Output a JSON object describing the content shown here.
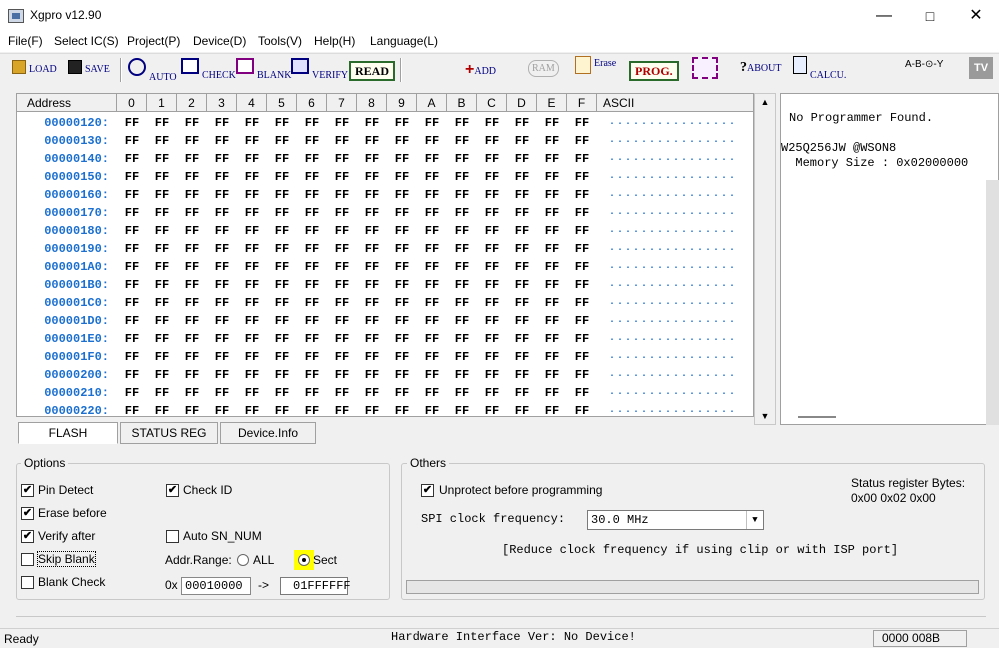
{
  "window": {
    "title": "Xgpro v12.90"
  },
  "menu": [
    "File(F)",
    "Select IC(S)",
    "Project(P)",
    "Device(D)",
    "Tools(V)",
    "Help(H)",
    "Language(L)"
  ],
  "toolbar": {
    "load": "LOAD",
    "save": "SAVE",
    "auto": "AUTO",
    "check": "CHECK",
    "blank": "BLANK",
    "verify": "VERIFY",
    "read": "READ",
    "add": "ADD",
    "ram": "RAM",
    "erase": "Erase",
    "prog": "PROG.",
    "about": "ABOUT",
    "calcu": "CALCU.",
    "tv": "TV"
  },
  "hex": {
    "columns": [
      "Address",
      "0",
      "1",
      "2",
      "3",
      "4",
      "5",
      "6",
      "7",
      "8",
      "9",
      "A",
      "B",
      "C",
      "D",
      "E",
      "F",
      "ASCII"
    ],
    "rows": [
      "00000120:",
      "00000130:",
      "00000140:",
      "00000150:",
      "00000160:",
      "00000170:",
      "00000180:",
      "00000190:",
      "000001A0:",
      "000001B0:",
      "000001C0:",
      "000001D0:",
      "000001E0:",
      "000001F0:",
      "00000200:",
      "00000210:",
      "00000220:"
    ],
    "byte": "FF",
    "ascii_row": "................"
  },
  "info": {
    "line1": "No Programmer Found.",
    "line2": "W25Q256JW @WSON8",
    "line3": "  Memory Size : 0x02000000"
  },
  "tabs": [
    "FLASH",
    "STATUS REG",
    "Device.Info"
  ],
  "options": {
    "title": "Options",
    "pin_detect": "Pin Detect",
    "erase_before": "Erase before",
    "verify_after": "Verify after",
    "skip_blank": "Skip Blank",
    "blank_check": "Blank Check",
    "check_id": "Check ID",
    "auto_sn": "Auto SN_NUM",
    "addr_range": "Addr.Range:",
    "all": "ALL",
    "sect": "Sect",
    "hex_prefix": "0x",
    "start": "00010000",
    "arrow": "->",
    "end": "01FFFFFF",
    "check": "✔"
  },
  "others": {
    "title": "Others",
    "unprotect": "Unprotect before programming",
    "spi_label": "SPI clock frequency:",
    "spi_value": "30.0 MHz",
    "hint": "[Reduce clock frequency if using clip or with ISP port]",
    "status_reg_label": "Status register Bytes:",
    "status_reg_value": "0x00 0x02 0x00"
  },
  "status": {
    "left": "Ready",
    "center": "Hardware Interface Ver: No Device!",
    "right": "0000 008B"
  },
  "colors": {
    "address": "#1a6fd0",
    "highlight": "#ffff00",
    "accent_green": "#2a6a2a"
  }
}
